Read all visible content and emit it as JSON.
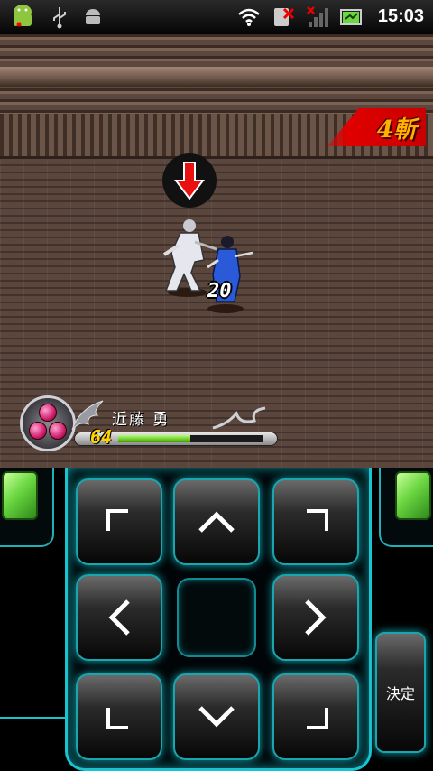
{
  "status_bar": {
    "time": "15:03",
    "icons": [
      "android-debug-icon",
      "usb-icon",
      "android-icon",
      "wifi-icon",
      "sim-error-icon",
      "signal-icon",
      "battery-icon"
    ]
  },
  "game": {
    "combo_label": "4斬",
    "damage_number": "20",
    "character": {
      "name": "近藤 勇",
      "hp": "64",
      "hp_fraction": 0.5
    }
  },
  "controller": {
    "confirm_label": "決定",
    "accent_color": "#19c4d0",
    "button_color": "#6ad640"
  }
}
